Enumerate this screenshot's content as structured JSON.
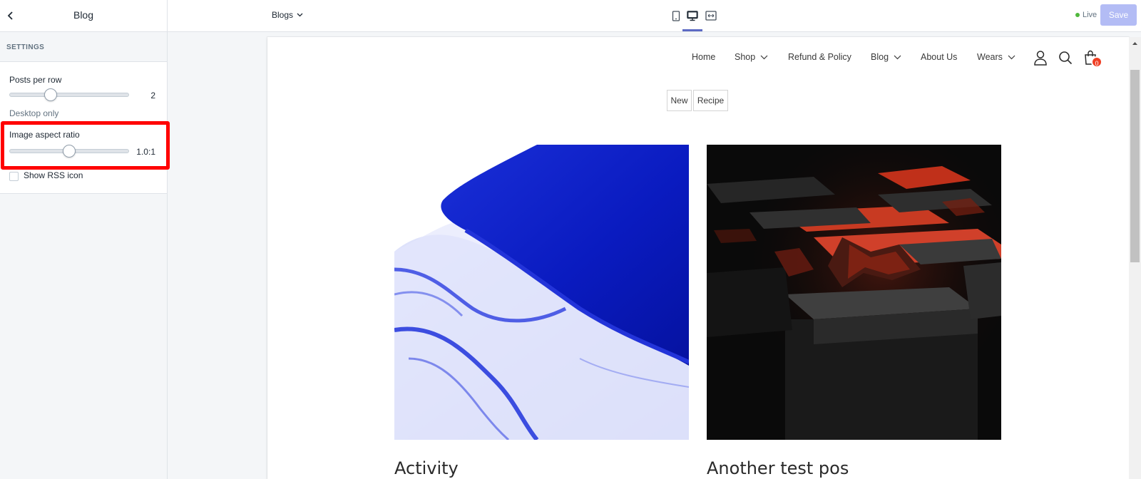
{
  "sidebar": {
    "title": "Blog",
    "back_icon": "chevron-left-icon",
    "section_heading": "SETTINGS",
    "posts_per_row": {
      "label": "Posts per row",
      "value": "2",
      "level": 0.33,
      "help": "Desktop only"
    },
    "image_aspect_ratio": {
      "label": "Image aspect ratio",
      "value": "1.0:1",
      "level": 0.5
    },
    "show_rss": {
      "label": "Show RSS icon",
      "checked": false
    }
  },
  "topbar": {
    "template_select": "Blogs",
    "view_modes": [
      "mobile-view-icon",
      "desktop-view-icon",
      "fullscreen-view-icon"
    ],
    "active_view": "desktop-view-icon",
    "status": "Live",
    "status_color": "#50b83c",
    "save_label": "Save"
  },
  "preview": {
    "nav": [
      {
        "label": "Home",
        "dropdown": false
      },
      {
        "label": "Shop",
        "dropdown": true
      },
      {
        "label": "Refund & Policy",
        "dropdown": false
      },
      {
        "label": "Blog",
        "dropdown": true
      },
      {
        "label": "About Us",
        "dropdown": false
      },
      {
        "label": "Wears",
        "dropdown": true
      }
    ],
    "icons": [
      "account-icon",
      "search-icon",
      "cart-icon"
    ],
    "cart_count": "0",
    "tags": [
      "New",
      "Recipe"
    ],
    "posts": [
      {
        "title": "Activity",
        "image": "blue-fabric-image"
      },
      {
        "title": "Another test pos",
        "image": "dark-red-cubes-image"
      }
    ]
  },
  "colors": {
    "accent": "#5c6ac4",
    "save_disabled": "#b3bcf5",
    "badge": "#ef3e23",
    "highlight": "#ff0000"
  }
}
